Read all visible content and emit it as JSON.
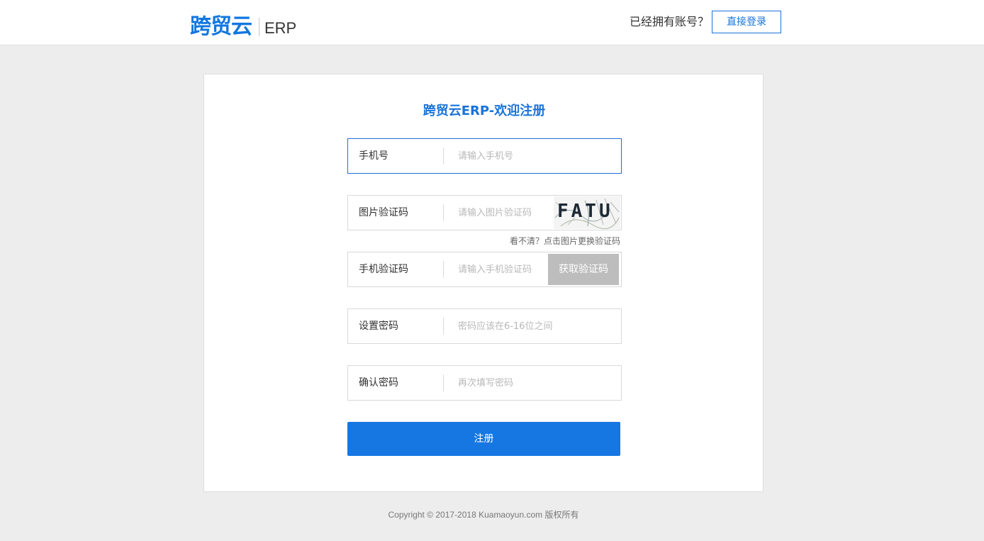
{
  "header": {
    "logo_mark": "跨贸云",
    "logo_text": "ERP",
    "have_account": "已经拥有账号？",
    "login_button": "直接登录"
  },
  "form": {
    "title": "跨贸云ERP-欢迎注册",
    "phone": {
      "label": "手机号",
      "placeholder": "请输入手机号",
      "value": ""
    },
    "image_code": {
      "label": "图片验证码",
      "placeholder": "请输入图片验证码",
      "value": "",
      "captcha_text": "FATU"
    },
    "captcha_hint": "看不清？点击图片更换验证码",
    "sms_code": {
      "label": "手机验证码",
      "placeholder": "请输入手机验证码",
      "value": "",
      "button": "获取验证码"
    },
    "password": {
      "label": "设置密码",
      "placeholder": "密码应该在6-16位之间",
      "value": ""
    },
    "confirm_password": {
      "label": "确认密码",
      "placeholder": "再次填写密码",
      "value": ""
    },
    "submit": "注册"
  },
  "footer": {
    "copyright": "Copyright © 2017-2018 Kuamaoyun.com 版权所有"
  },
  "colors": {
    "accent": "#1677e2",
    "background": "#ededed",
    "disabled_button": "#bdbdbd"
  }
}
